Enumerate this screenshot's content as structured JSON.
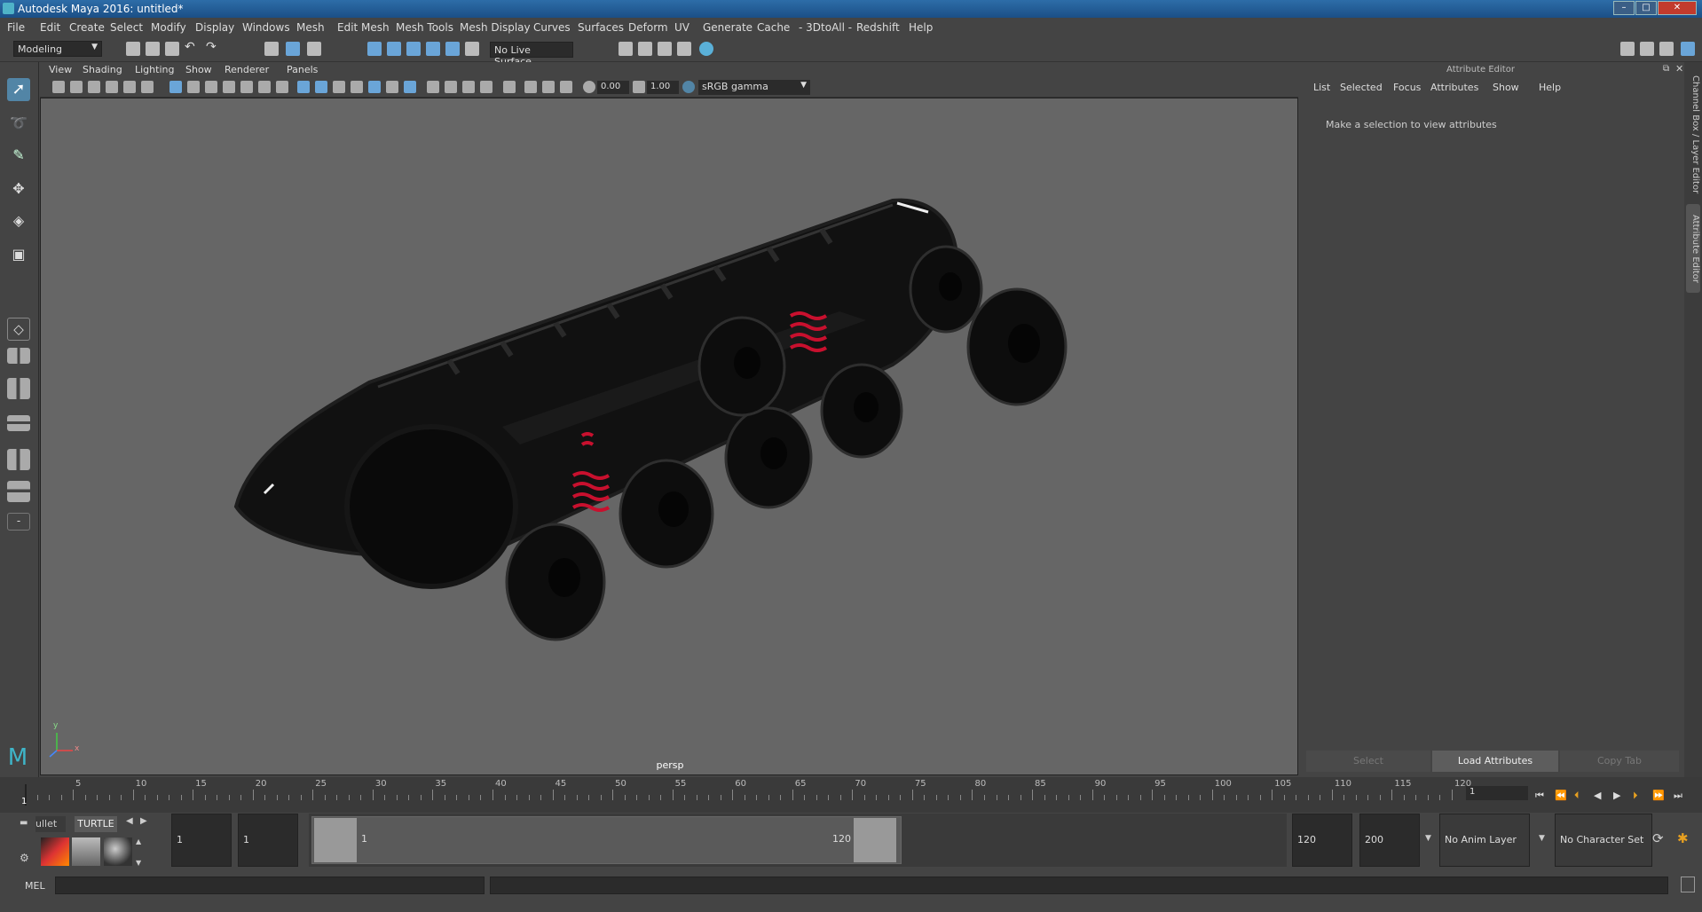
{
  "window": {
    "title": "Autodesk Maya 2016: untitled*",
    "min": "–",
    "max": "□",
    "close": "✕"
  },
  "menus": [
    "File",
    "Edit",
    "Create",
    "Select",
    "Modify",
    "Display",
    "Windows",
    "Mesh",
    "Edit Mesh",
    "Mesh Tools",
    "Mesh Display",
    "Curves",
    "Surfaces",
    "Deform",
    "UV",
    "Generate",
    "Cache",
    "- 3DtoAll -",
    "Redshift",
    "Help"
  ],
  "toolbar": {
    "mode": "Modeling",
    "live_surface": "No Live Surface"
  },
  "viewport": {
    "menus": [
      "View",
      "Shading",
      "Lighting",
      "Show",
      "Renderer",
      "Panels"
    ],
    "exposure": "0.00",
    "gamma": "1.00",
    "color_space": "sRGB gamma",
    "camera": "persp",
    "axis_x": "x",
    "axis_y": "y"
  },
  "attribute_editor": {
    "title": "Attribute Editor",
    "menus": [
      "List",
      "Selected",
      "Focus",
      "Attributes",
      "Show",
      "Help"
    ],
    "message": "Make a selection to view attributes",
    "buttons": {
      "select": "Select",
      "load": "Load Attributes",
      "copy": "Copy Tab"
    }
  },
  "side_tabs": {
    "channel_box": "Channel Box / Layer Editor",
    "attribute_editor": "Attribute Editor"
  },
  "timeline": {
    "ticks": [
      "5",
      "10",
      "15",
      "20",
      "25",
      "30",
      "35",
      "40",
      "45",
      "50",
      "55",
      "60",
      "65",
      "70",
      "75",
      "80",
      "85",
      "90",
      "95",
      "100",
      "105",
      "110",
      "115",
      "120"
    ],
    "current_label": "1",
    "current_frame": "1"
  },
  "range": {
    "shelf_tab1": "ullet",
    "shelf_tab2": "TURTLE",
    "start": "1",
    "playback_start": "1",
    "slider_start": "1",
    "slider_end": "120",
    "playback_end": "120",
    "end": "200",
    "anim_layer": "No Anim Layer",
    "char_set": "No Character Set"
  },
  "cmd": {
    "lang": "MEL"
  },
  "colors": {
    "title_bar": "#1b4f86",
    "accent": "#5285a6",
    "spring": "#c8102e"
  }
}
